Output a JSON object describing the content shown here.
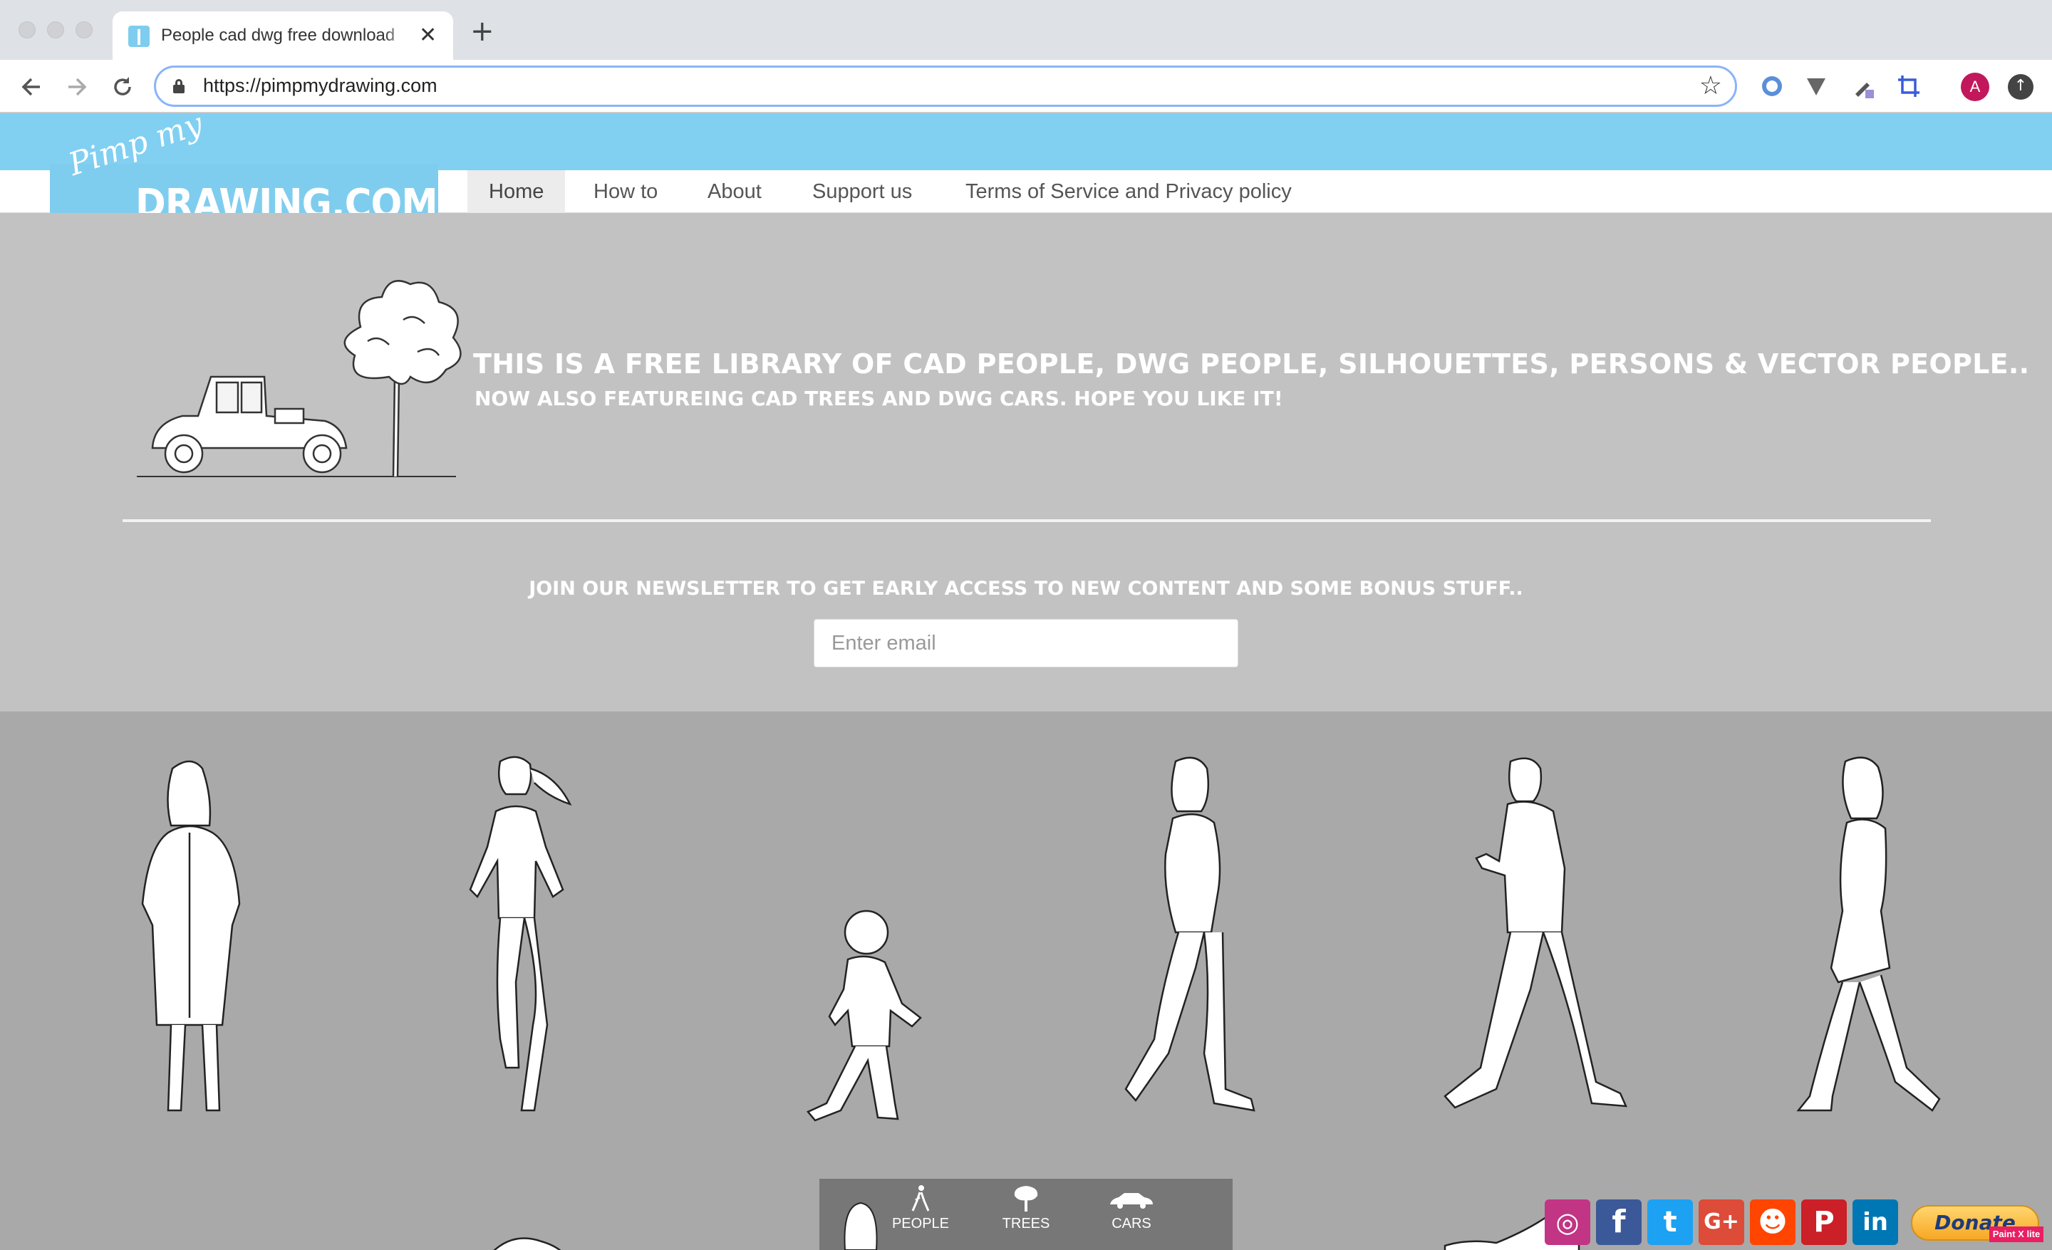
{
  "browser": {
    "tab_title": "People cad dwg free download",
    "tab_close": "✕",
    "new_tab": "+",
    "url": "https://pimpmydrawing.com",
    "avatar_letter": "A",
    "icons": [
      "back-icon",
      "forward-icon",
      "reload-icon",
      "lock-icon",
      "star-icon",
      "extension-icons",
      "profile-avatar",
      "update-icon"
    ]
  },
  "logo": {
    "script": "Pimp my",
    "main": "DRAWING.COM"
  },
  "nav": {
    "items": [
      {
        "label": "Home",
        "active": true
      },
      {
        "label": "How to"
      },
      {
        "label": "About"
      },
      {
        "label": "Support us"
      },
      {
        "label": "Terms of Service and Privacy policy"
      }
    ]
  },
  "hero": {
    "headline": "THIS IS A FREE LIBRARY OF CAD PEOPLE, DWG PEOPLE, SILHOUETTES, PERSONS & VECTOR PEOPLE..",
    "subheadline": "NOW ALSO FEATUREING CAD TREES AND DWG CARS. HOPE YOU LIKE IT!"
  },
  "newsletter": {
    "text": "JOIN OUR NEWSLETTER TO GET EARLY ACCESS TO NEW CONTENT AND SOME BONUS STUFF..",
    "placeholder": "Enter email"
  },
  "categories": [
    {
      "label": "PEOPLE",
      "icon": "person-icon"
    },
    {
      "label": "TREES",
      "icon": "tree-icon"
    },
    {
      "label": "CARS",
      "icon": "car-icon"
    }
  ],
  "social": [
    {
      "name": "instagram",
      "glyph": "◎",
      "color": "#c13584"
    },
    {
      "name": "facebook",
      "glyph": "f",
      "color": "#3b5998"
    },
    {
      "name": "twitter",
      "glyph": "t",
      "color": "#1da1f2"
    },
    {
      "name": "google-plus",
      "glyph": "G+",
      "color": "#dd4b39"
    },
    {
      "name": "reddit",
      "glyph": "☻",
      "color": "#ff4500"
    },
    {
      "name": "pinterest",
      "glyph": "P",
      "color": "#cb2027"
    },
    {
      "name": "linkedin",
      "glyph": "in",
      "color": "#0077b5"
    }
  ],
  "donate": {
    "label": "Donate",
    "badge": "Paint X lite"
  },
  "colors": {
    "sky": "#81d0f2",
    "hero_bg": "#c2c2c2",
    "gallery_bg": "#a9a9a9",
    "category_bar": "#777777"
  }
}
